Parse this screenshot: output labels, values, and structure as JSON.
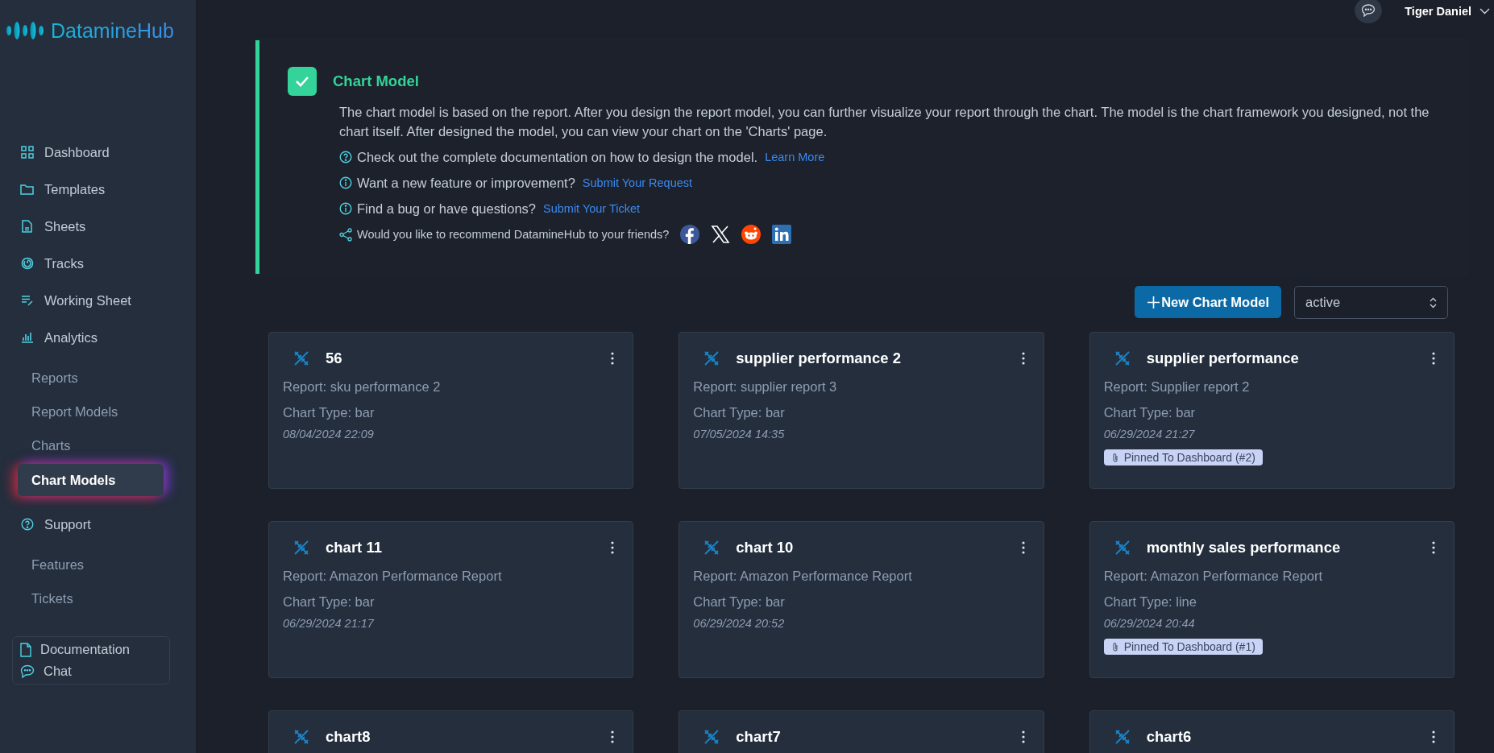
{
  "logo": {
    "text": "DatamineHub"
  },
  "topbar": {
    "user": "Tiger Daniel"
  },
  "sidebar": {
    "items": [
      {
        "label": "Dashboard",
        "selected": false
      },
      {
        "label": "Templates",
        "selected": false
      },
      {
        "label": "Sheets",
        "selected": false
      },
      {
        "label": "Tracks",
        "selected": false
      },
      {
        "label": "Working Sheet",
        "selected": false
      },
      {
        "label": "Analytics",
        "selected": false,
        "children": [
          {
            "label": "Reports",
            "selected": false
          },
          {
            "label": "Report Models",
            "selected": false
          },
          {
            "label": "Charts",
            "selected": false
          },
          {
            "label": "Chart Models",
            "selected": true
          }
        ]
      },
      {
        "label": "Support",
        "selected": false,
        "children": [
          {
            "label": "Features",
            "selected": false
          },
          {
            "label": "Tickets",
            "selected": false
          }
        ]
      }
    ],
    "footer_links": [
      "Documentation",
      "Chat"
    ]
  },
  "banner": {
    "title": "Chart Model",
    "description": "The chart model is based on the report. After you design the report model, you can further visualize your report through the chart. The model is the chart framework you designed, not the chart itself. After designed the model, you can view your chart on the 'Charts' page.",
    "lines": [
      {
        "kind": "help",
        "text": "Check out the complete documentation on how to design the model.",
        "link": "Learn More"
      },
      {
        "kind": "info",
        "text": "Want a new feature or improvement?",
        "link": "Submit Your Request"
      },
      {
        "kind": "info",
        "text": "Find a bug or have questions?",
        "link": "Submit Your Ticket"
      }
    ],
    "share_text": "Would you like to recommend DatamineHub to your friends?"
  },
  "toolbar": {
    "new_button": "New Chart Model",
    "status_filter": "active"
  },
  "cards": [
    {
      "title": "56",
      "report": "Report: sku performance 2",
      "chart_type": "Chart Type: bar",
      "date": "08/04/2024 22:09"
    },
    {
      "title": "supplier performance 2",
      "report": "Report: supplier report 3",
      "chart_type": "Chart Type: bar",
      "date": "07/05/2024 14:35"
    },
    {
      "title": "supplier performance",
      "report": "Report: Supplier report 2",
      "chart_type": "Chart Type: bar",
      "date": "06/29/2024 21:27",
      "pinned": "Pinned To Dashboard (#2)"
    },
    {
      "title": "chart 11",
      "report": "Report: Amazon Performance Report",
      "chart_type": "Chart Type: bar",
      "date": "06/29/2024 21:17"
    },
    {
      "title": "chart 10",
      "report": "Report: Amazon Performance Report",
      "chart_type": "Chart Type: bar",
      "date": "06/29/2024 20:52"
    },
    {
      "title": "monthly sales performance",
      "report": "Report: Amazon Performance Report",
      "chart_type": "Chart Type: line",
      "date": "06/29/2024 20:44",
      "pinned": "Pinned To Dashboard (#1)"
    },
    {
      "title": "chart8"
    },
    {
      "title": "chart7"
    },
    {
      "title": "chart6"
    }
  ]
}
